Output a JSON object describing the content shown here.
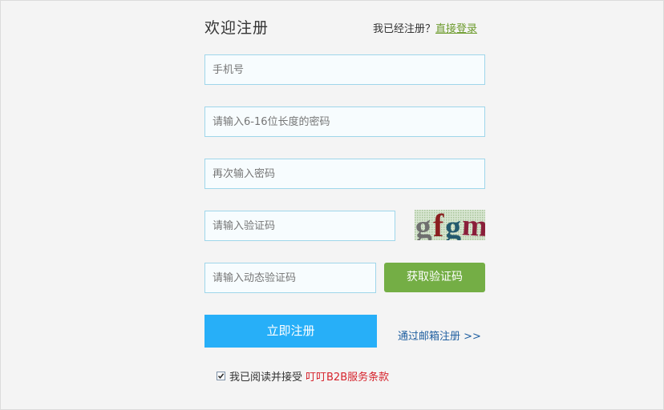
{
  "header": {
    "title": "欢迎注册",
    "login_prompt": "我已经注册？",
    "login_link": "直接登录"
  },
  "form": {
    "phone_placeholder": "手机号",
    "password_placeholder": "请输入6-16位长度的密码",
    "password_confirm_placeholder": "再次输入密码",
    "captcha_placeholder": "请输入验证码",
    "captcha_text": "gfgm",
    "sms_code_placeholder": "请输入动态验证码",
    "sms_button_label": "获取验证码",
    "register_button_label": "立即注册",
    "email_register_link": "通过邮箱注册 >>"
  },
  "agreement": {
    "checked": true,
    "text": "我已阅读并接受",
    "terms_link": "叮叮B2B服务条款"
  },
  "colors": {
    "input_border": "#9fd6ea",
    "sms_button": "#74ae45",
    "register_button": "#27aff8",
    "login_link": "#6d9b2d",
    "terms_link": "#d6232c",
    "email_link": "#1f5fa0"
  }
}
